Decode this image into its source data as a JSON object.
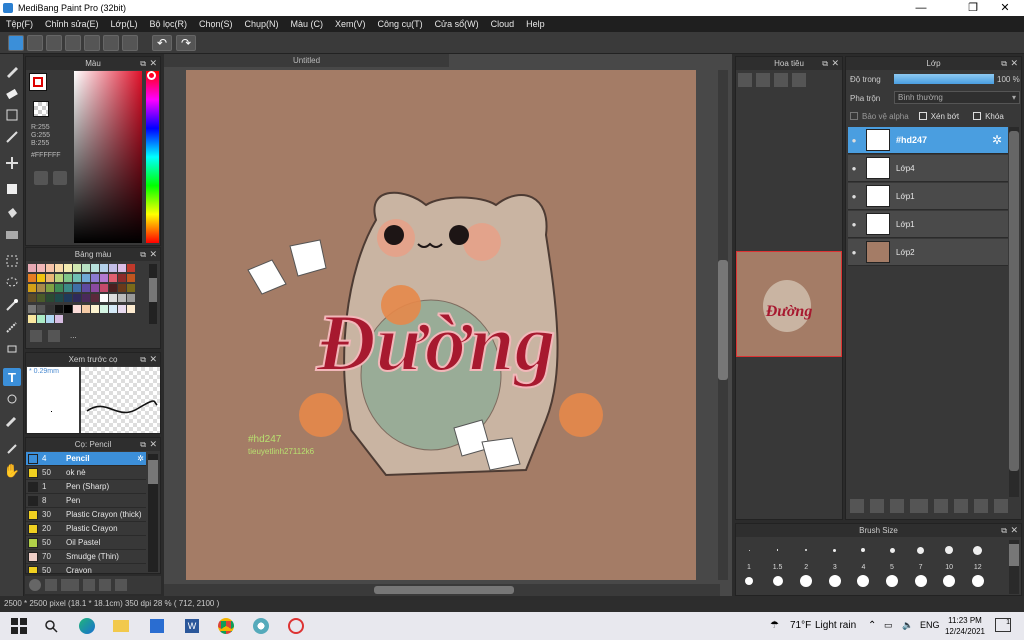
{
  "window": {
    "title": "MediBang Paint Pro (32bit)",
    "minimize": "—",
    "maximize": "❐",
    "close": "✕"
  },
  "menu": [
    "Tệp(F)",
    "Chỉnh sửa(E)",
    "Lớp(L)",
    "Bộ lọc(R)",
    "Chọn(S)",
    "Chụp(N)",
    "Màu (C)",
    "Xem(V)",
    "Công cụ(T)",
    "Cửa sổ(W)",
    "Cloud",
    "Help"
  ],
  "canvas_tab": "Untitled",
  "color_panel": {
    "title": "Màu",
    "r": "R:255",
    "g": "G:255",
    "b": "B:255",
    "hex": "#FFFFFF"
  },
  "palette_panel": {
    "title": "Bảng màu",
    "more": "...",
    "swatches": [
      "#e7a9b3",
      "#f1b7b7",
      "#f6c4a8",
      "#f8d9a8",
      "#f3eab0",
      "#cfe7b0",
      "#b7e0c2",
      "#b7e0dc",
      "#b3d0ea",
      "#c3bde6",
      "#dcbde6",
      "#c0392b",
      "#e67e22",
      "#f1c40f",
      "#eab676",
      "#b7d37b",
      "#7fc58a",
      "#6fbfb3",
      "#6fa8d6",
      "#8c7ad0",
      "#b27ad0",
      "#e06070",
      "#8e2b2b",
      "#c0551f",
      "#d4a017",
      "#a88a4a",
      "#7fa043",
      "#3e8a57",
      "#3b8a86",
      "#3f6fa6",
      "#5f4aa0",
      "#8a4aa0",
      "#c44a6a",
      "#4a1f1f",
      "#6a3a1a",
      "#7a6a1a",
      "#5a4a2a",
      "#4a5a2a",
      "#2a4a32",
      "#1f4a4a",
      "#1f3a5a",
      "#2f2a5a",
      "#4a2a5a",
      "#5a2a3a",
      "#ffffff",
      "#dddddd",
      "#bbbbbb",
      "#999999",
      "#777777",
      "#555555",
      "#333333",
      "#111111",
      "#000000",
      "#fadbd8",
      "#f5cba7",
      "#fcf3cf",
      "#d5f5e3",
      "#d6eaf8",
      "#e8daef",
      "#fdebd0",
      "#f9e79f",
      "#abebc6",
      "#aed6f1",
      "#d7bde2"
    ]
  },
  "brush_preview": {
    "title": "Xem trước cọ",
    "size": "* 0.29mm"
  },
  "brush_panel": {
    "title": "Cọ: Pencil",
    "items": [
      {
        "size": "4",
        "name": "Pencil",
        "color": "#3c8fd9",
        "selected": true
      },
      {
        "size": "50",
        "name": "ok nè",
        "color": "#f0d020",
        "selected": false
      },
      {
        "size": "1",
        "name": "Pen (Sharp)",
        "color": "#222222",
        "selected": false
      },
      {
        "size": "8",
        "name": "Pen",
        "color": "#222222",
        "selected": false
      },
      {
        "size": "30",
        "name": "Plastic Crayon (thick)",
        "color": "#f0d020",
        "selected": false
      },
      {
        "size": "20",
        "name": "Plastic Crayon",
        "color": "#f0d020",
        "selected": false
      },
      {
        "size": "50",
        "name": "Oil Pastel",
        "color": "#b0d048",
        "selected": false
      },
      {
        "size": "70",
        "name": "Smudge (Thin)",
        "color": "#f0d0c8",
        "selected": false
      },
      {
        "size": "50",
        "name": "Crayon",
        "color": "#f0d020",
        "selected": false
      }
    ]
  },
  "navigator": {
    "title": "Hoa tiêu"
  },
  "layer_panel": {
    "title": "Lớp",
    "opacity_label": "Độ trong",
    "opacity_value": "100 %",
    "opacity": 100,
    "blend_label": "Pha trộn",
    "blend_value": "Bình thường",
    "protect_alpha": "Bảo vệ alpha",
    "clipping": "Xén bớt",
    "lock": "Khóa",
    "layers": [
      {
        "name": "#hd247",
        "selected": true
      },
      {
        "name": "Lớp4",
        "selected": false
      },
      {
        "name": "Lớp1",
        "selected": false
      },
      {
        "name": "Lớp1",
        "selected": false
      },
      {
        "name": "Lớp2",
        "selected": false
      }
    ]
  },
  "brush_size": {
    "title": "Brush Size",
    "sizes": [
      "1",
      "1.5",
      "2",
      "3",
      "4",
      "5",
      "7",
      "10",
      "12"
    ]
  },
  "artwork": {
    "title_text": "Đường",
    "watermark1": "#hd247",
    "watermark2": "tieuyetlinh27112k6"
  },
  "status": "2500 * 2500 pixel   (18.1 * 18.1cm)   350 dpi   28 %   ( 712, 2100 )",
  "taskbar": {
    "weather_temp": "71°F",
    "weather_text": "Light rain",
    "lang": "ENG",
    "time": "11:23 PM",
    "date": "12/24/2021",
    "notif": "1"
  }
}
